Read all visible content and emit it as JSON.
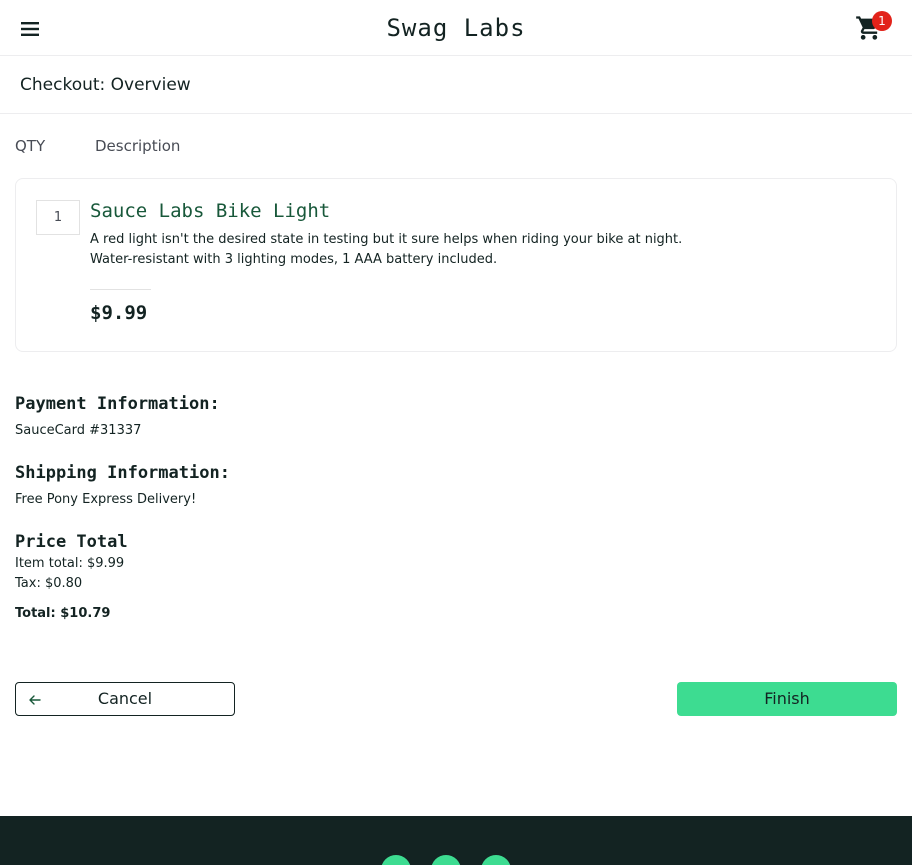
{
  "header": {
    "brand": "Swag Labs",
    "cart_count": "1",
    "menu_icon": "menu-icon",
    "cart_icon": "cart-icon"
  },
  "subheader": {
    "title": "Checkout: Overview"
  },
  "columns": {
    "qty": "QTY",
    "description": "Description"
  },
  "item": {
    "quantity": "1",
    "name": "Sauce Labs Bike Light",
    "description_line1": "A red light isn't the desired state in testing but it sure helps when riding your bike at night.",
    "description_line2": "Water-resistant with 3 lighting modes, 1 AAA battery included.",
    "price": "$9.99"
  },
  "summary": {
    "payment_label": "Payment Information:",
    "payment_value": "SauceCard #31337",
    "shipping_label": "Shipping Information:",
    "shipping_value": "Free Pony Express Delivery!",
    "price_label": "Price Total",
    "item_total": "Item total: $9.99",
    "tax": "Tax: $0.80",
    "total": "Total: $10.79"
  },
  "buttons": {
    "cancel": "Cancel",
    "finish": "Finish"
  },
  "colors": {
    "accent": "#3ddc91",
    "footer_bg": "#132322",
    "item_name": "#18583a",
    "badge": "#e2231a"
  },
  "footer": {
    "social_icons": [
      "twitter-icon",
      "facebook-icon",
      "linkedin-icon"
    ]
  }
}
